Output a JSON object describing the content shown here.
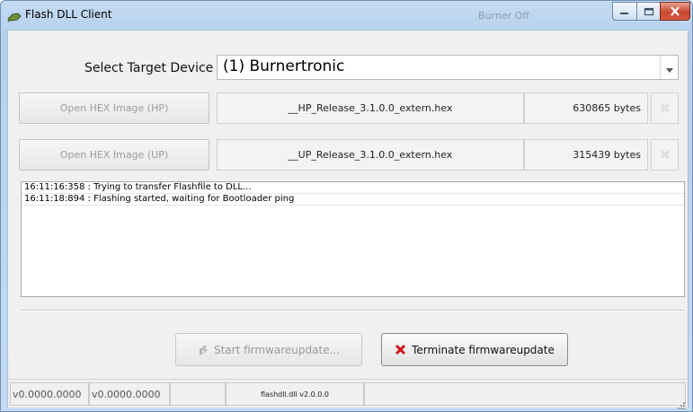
{
  "window": {
    "title": "Flash DLL Client",
    "status_text": "Burner Off",
    "icons": {
      "app": "plug-icon",
      "minimize": "minimize-icon",
      "maximize": "maximize-icon",
      "close": "close-icon"
    }
  },
  "device": {
    "label": "Select Target Device",
    "selected": "(1) Burnertronic"
  },
  "hex_images": [
    {
      "button_label": "Open HEX Image (HP)",
      "filename": "__HP_Release_3.1.0.0_extern.hex",
      "size": "630865 bytes",
      "clear_icon": "clear-icon"
    },
    {
      "button_label": "Open HEX Image (UP)",
      "filename": "__UP_Release_3.1.0.0_extern.hex",
      "size": "315439 bytes",
      "clear_icon": "clear-icon"
    }
  ],
  "log": {
    "lines": [
      "16:11:16:358 : Trying to transfer Flashfile to DLL...",
      "16:11:18:894 : Flashing started, waiting for Bootloader ping"
    ]
  },
  "actions": {
    "start_label": "Start firmwareupdate...",
    "terminate_label": "Terminate firmwareupdate",
    "start_icon": "flash-icon",
    "terminate_icon": "x-icon",
    "terminate_icon_color": "#d0141a"
  },
  "statusbar": {
    "version1": "v0.0000.0000",
    "version2": "v0.0000.0000",
    "cell3": "",
    "dll": "flashdll.dll v2.0.0.0"
  }
}
